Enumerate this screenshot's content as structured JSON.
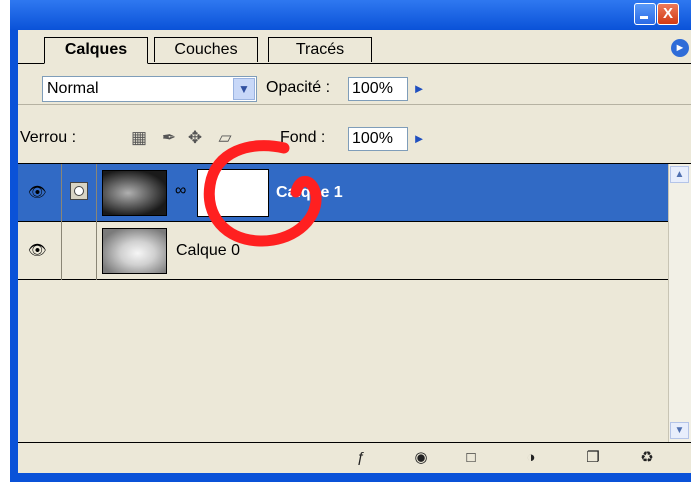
{
  "tabs": [
    "Calques",
    "Couches",
    "Tracés"
  ],
  "blend_mode": "Normal",
  "opacity_label": "Opacité :",
  "opacity_value": "100%",
  "lock_label": "Verrou :",
  "fill_label": "Fond :",
  "fill_value": "100%",
  "layers": [
    {
      "name": "Calque 1",
      "selected": true
    },
    {
      "name": "Calque 0",
      "selected": false
    }
  ],
  "titlebar_buttons": {
    "close": "X"
  },
  "colors": {
    "selection": "#316ac5",
    "annotation": "#ff2020",
    "titlebar": "#0a52d8"
  }
}
